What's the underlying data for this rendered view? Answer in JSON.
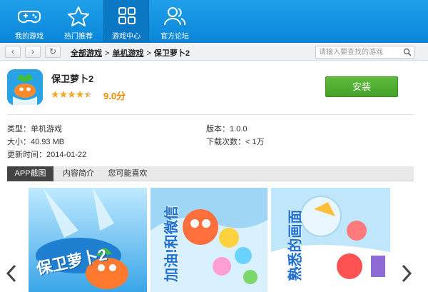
{
  "nav": {
    "items": [
      {
        "label": "我的游戏",
        "icon": "gamepad-icon"
      },
      {
        "label": "热门推荐",
        "icon": "star-icon"
      },
      {
        "label": "游戏中心",
        "icon": "grid-icon",
        "active": true
      },
      {
        "label": "官方论坛",
        "icon": "users-icon"
      }
    ]
  },
  "addressbar": {
    "breadcrumb": [
      "全部游戏",
      "单机游戏",
      "保卫萝卜2"
    ],
    "separator": ">",
    "search_placeholder": "请输入要查找的游戏"
  },
  "app": {
    "title": "保卫萝卜2",
    "rating_stars": 4.5,
    "score": "9.0分",
    "install_label": "安装"
  },
  "meta": {
    "type": "类型：单机游戏",
    "version": "版本：1.0.0",
    "size": "大小：40.93 MB",
    "downloads": "下载次数：< 1万",
    "updated": "更新时间：2014-01-22"
  },
  "tabs": [
    {
      "label": "APP截图",
      "active": true
    },
    {
      "label": "内容简介"
    },
    {
      "label": "您可能喜欢"
    }
  ],
  "screenshots": {
    "captions": [
      "保卫萝卜2",
      "加油!和微信",
      "熟悉的画面"
    ]
  },
  "colors": {
    "topbar": "#1496e2",
    "install": "#4fae33",
    "score": "#f08a00",
    "star": "#f5a623"
  }
}
